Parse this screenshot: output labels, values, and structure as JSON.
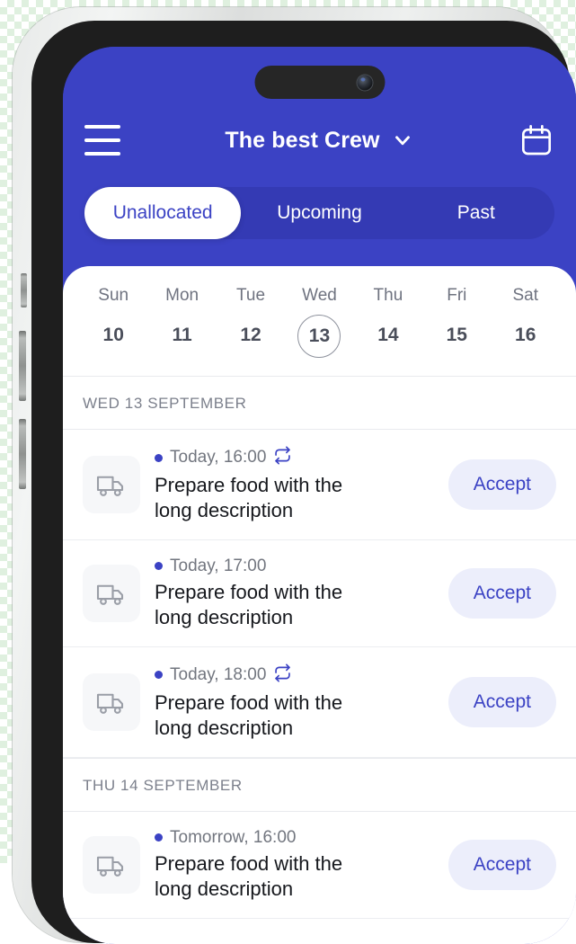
{
  "header": {
    "menu_icon": "hamburger-menu-icon",
    "title": "The best Crew",
    "chevron_icon": "chevron-down-icon",
    "calendar_icon": "calendar-icon",
    "background_color": "#3b42c4"
  },
  "tabs": {
    "items": [
      {
        "label": "Unallocated",
        "active": true
      },
      {
        "label": "Upcoming",
        "active": false
      },
      {
        "label": "Past",
        "active": false
      }
    ],
    "active_tab_bg": "#ffffff",
    "active_tab_color": "#3b42c4",
    "track_color": "#343ab4"
  },
  "week_strip": {
    "days": [
      {
        "name": "Sun",
        "num": "10",
        "selected": false
      },
      {
        "name": "Mon",
        "num": "11",
        "selected": false
      },
      {
        "name": "Tue",
        "num": "12",
        "selected": false
      },
      {
        "name": "Wed",
        "num": "13",
        "selected": true
      },
      {
        "name": "Thu",
        "num": "14",
        "selected": false
      },
      {
        "name": "Fri",
        "num": "15",
        "selected": false
      },
      {
        "name": "Sat",
        "num": "16",
        "selected": false
      }
    ]
  },
  "sections": [
    {
      "header": "WED 13 SEPTEMBER",
      "jobs": [
        {
          "thumb_icon": "truck-icon",
          "time": "Today, 16:00",
          "recurring": true,
          "recurring_icon": "repeat-icon",
          "title": "Prepare food with the long description",
          "action_label": "Accept"
        },
        {
          "thumb_icon": "truck-icon",
          "time": "Today, 17:00",
          "recurring": false,
          "recurring_icon": "repeat-icon",
          "title": "Prepare food with the long description",
          "action_label": "Accept"
        },
        {
          "thumb_icon": "truck-icon",
          "time": "Today, 18:00",
          "recurring": true,
          "recurring_icon": "repeat-icon",
          "title": "Prepare food with the long description",
          "action_label": "Accept"
        }
      ]
    },
    {
      "header": "THU 14 SEPTEMBER",
      "jobs": [
        {
          "thumb_icon": "truck-icon",
          "time": "Tomorrow, 16:00",
          "recurring": false,
          "recurring_icon": "repeat-icon",
          "title": "Prepare food with the long description",
          "action_label": "Accept"
        }
      ]
    }
  ],
  "device": {
    "dynamic_island": "dynamic-island",
    "camera": "front-camera",
    "buttons": [
      "silent-switch",
      "volume-up",
      "volume-down",
      "power"
    ]
  },
  "colors": {
    "brand": "#3b42c4",
    "accept_bg": "#eceefb",
    "card_bg": "#ffffff",
    "muted_text": "#72767f"
  }
}
